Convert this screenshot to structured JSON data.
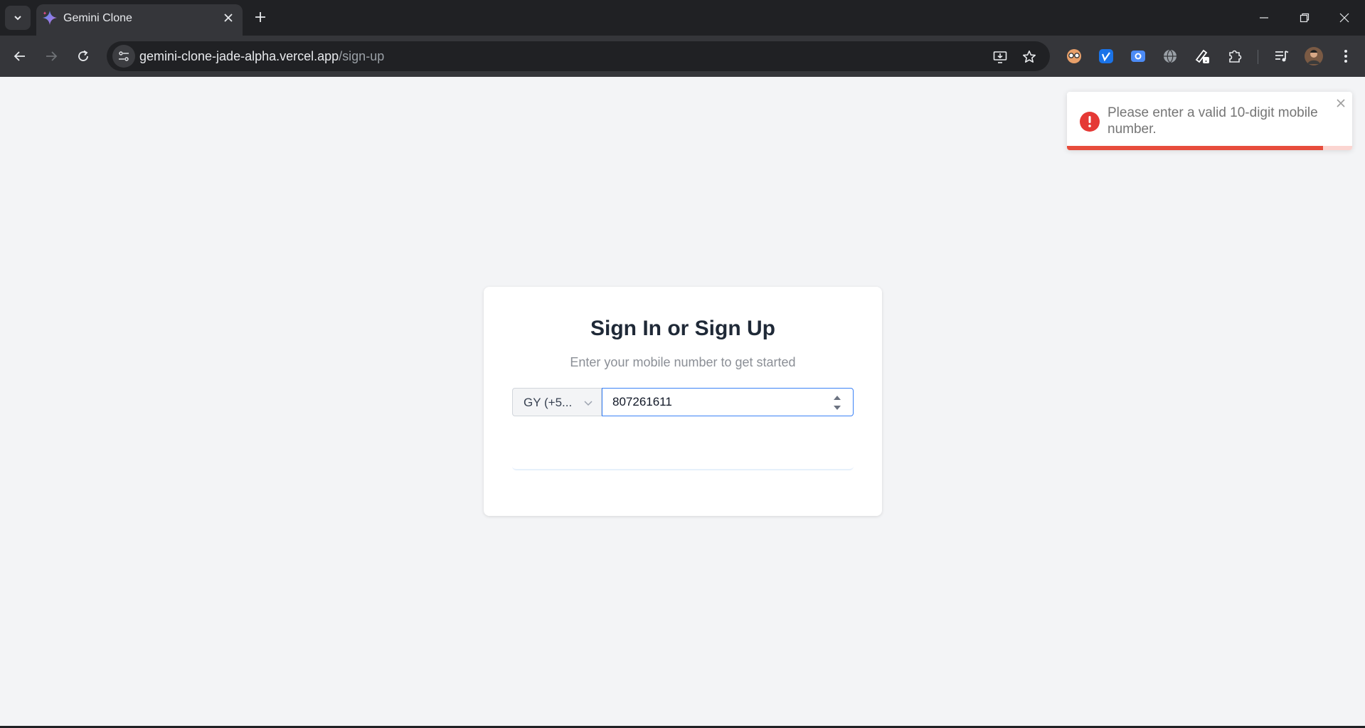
{
  "browser": {
    "tab": {
      "title": "Gemini Clone"
    },
    "address": {
      "host": "gemini-clone-jade-alpha.vercel.app",
      "path": "/sign-up"
    }
  },
  "signin": {
    "title": "Sign In or Sign Up",
    "subtitle": "Enter your mobile number to get started",
    "country_selected": "GY (+5...",
    "phone_value": "807261611"
  },
  "toast": {
    "message": "Please enter a valid 10-digit mobile number.",
    "type": "error",
    "progress_remaining": 0.898
  },
  "colors": {
    "error": "#e53935",
    "input_focus": "#3b82f6",
    "page_bg": "#f3f4f6"
  }
}
